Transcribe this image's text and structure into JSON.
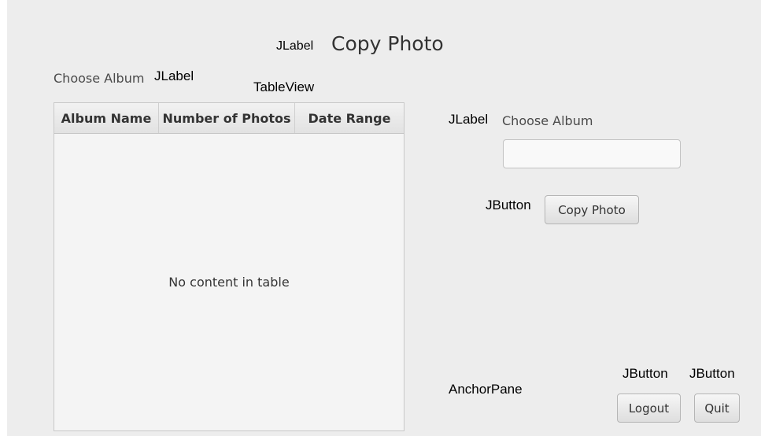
{
  "title": {
    "prefix": "JLabel",
    "text": "Copy Photo"
  },
  "left": {
    "choose_label": "Choose Album",
    "choose_type": "JLabel",
    "table_type": "TableView"
  },
  "table": {
    "columns": [
      "Album Name",
      "Number of Photos",
      "Date Range"
    ],
    "placeholder": "No content in table"
  },
  "right": {
    "label_type": "JLabel",
    "choose_label": "Choose Album",
    "button_type": "JButton",
    "copy_button": "Copy Photo"
  },
  "bottom": {
    "anchor_label": "AnchorPane",
    "logout_type": "JButton",
    "quit_type": "JButton",
    "logout": "Logout",
    "quit": "Quit"
  }
}
